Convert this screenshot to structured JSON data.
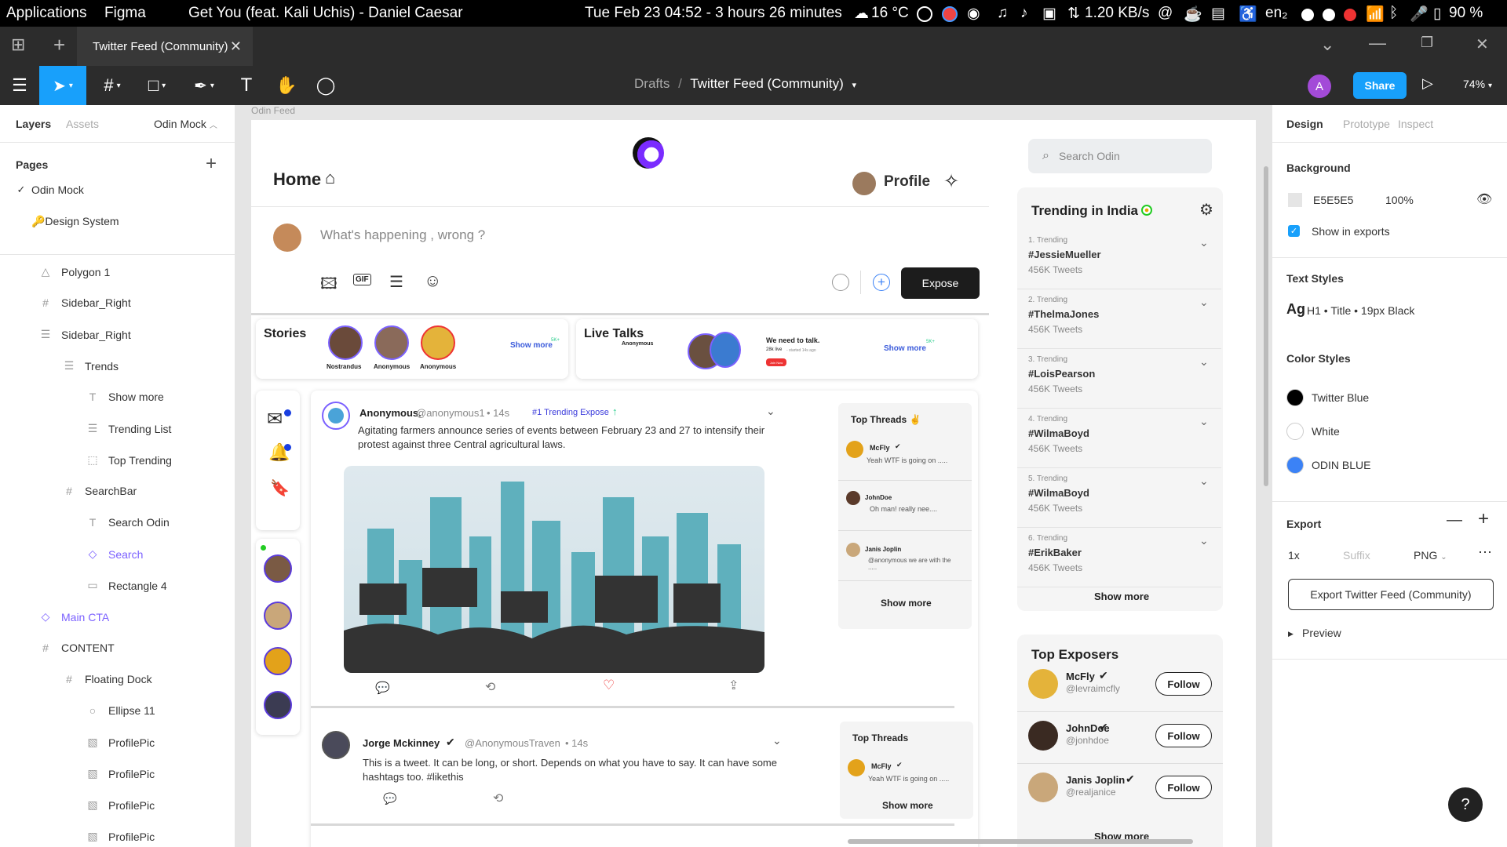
{
  "os_bar": {
    "applications": "Applications",
    "app_name": "Figma",
    "now_playing": "Get You (feat. Kali Uchis) - Daniel Caesar",
    "datetime": "Tue Feb 23  04:52 - 3 hours 26 minutes",
    "weather": "16 °C",
    "network_speed": "1.20 KB/s",
    "keyboard_layout": "en₂",
    "battery": "90 %"
  },
  "tab_bar": {
    "tab_title": "Twitter Feed (Community)"
  },
  "toolbar": {
    "breadcrumb_parent": "Drafts",
    "breadcrumb_sep": "/",
    "file_name": "Twitter Feed (Community)",
    "user_initial": "A",
    "share_label": "Share",
    "zoom": "74%"
  },
  "left_panel": {
    "tab_layers": "Layers",
    "tab_assets": "Assets",
    "page_selector": "Odin Mock",
    "pages_heading": "Pages",
    "pages": [
      {
        "label": "Odin Mock",
        "current": true
      },
      {
        "label": "🔑Design System",
        "current": false
      }
    ],
    "layers": [
      {
        "label": "Polygon 1",
        "icon": "△"
      },
      {
        "label": "Sidebar_Right",
        "icon": "#"
      },
      {
        "label": "Sidebar_Right",
        "icon": "☰"
      },
      {
        "label": "Trends",
        "icon": "☰"
      },
      {
        "label": "Show more",
        "icon": "T"
      },
      {
        "label": "Trending List",
        "icon": "☰"
      },
      {
        "label": "Top Trending",
        "icon": "⬚"
      },
      {
        "label": "SearchBar",
        "icon": "#"
      },
      {
        "label": "Search Odin",
        "icon": "T"
      },
      {
        "label": "Search",
        "icon": "◇"
      },
      {
        "label": "Rectangle 4",
        "icon": "▭"
      },
      {
        "label": "Main CTA",
        "icon": "◇"
      },
      {
        "label": "CONTENT",
        "icon": "#"
      },
      {
        "label": "Floating Dock",
        "icon": "#"
      },
      {
        "label": "Ellipse 11",
        "icon": "○"
      },
      {
        "label": "ProfilePic",
        "icon": "▧"
      },
      {
        "label": "ProfilePic",
        "icon": "▧"
      },
      {
        "label": "ProfilePic",
        "icon": "▧"
      },
      {
        "label": "ProfilePic",
        "icon": "▧"
      }
    ]
  },
  "canvas": {
    "frame_label": "Odin Feed",
    "home_title": "Home",
    "profile_label": "Profile",
    "compose_placeholder": "What's happening , wrong ?",
    "expose_button": "Expose",
    "search_placeholder": "Search Odin",
    "stories": {
      "title": "Stories",
      "names": [
        "Nostrandus",
        "Anonymous",
        "Anonymous"
      ],
      "show_more": "Show more",
      "badge": "5K+"
    },
    "live_talks": {
      "title": "Live Talks",
      "subtitle": "Anonymous",
      "talk_title": "We need to talk.",
      "talk_meta": "28k live",
      "talk_started": "- started 14s ago",
      "join_label": "Join Now",
      "show_more": "Show more",
      "badge": "5K+"
    },
    "tweet1": {
      "name": "Anonymous.",
      "handle": "@anonymous1",
      "time": "14s",
      "tag": "#1 Trending Expose",
      "text": "Agitating farmers announce series of events between February 23 and 27 to intensify their protest against three Central agricultural laws."
    },
    "tweet2": {
      "name": "Jorge Mckinney",
      "handle": "@AnonymousTraven",
      "time": "14s",
      "text": "This is a tweet. It can be long, or short. Depends on what you have to say. It can have some hashtags too. #likethis"
    },
    "top_threads1": {
      "title": "Top Threads ✌️",
      "items": [
        {
          "name": "McFly",
          "text": "Yeah WTF is going on ....."
        },
        {
          "name": "JohnDoe",
          "text": "Oh man! really nee...."
        },
        {
          "name": "Janis Joplin",
          "text": "@anonymous we are with the ....."
        }
      ],
      "show_more": "Show more"
    },
    "top_threads2": {
      "title": "Top Threads",
      "items": [
        {
          "name": "McFly",
          "text": "Yeah WTF is going on ....."
        }
      ],
      "show_more": "Show more"
    },
    "trending": {
      "title": "Trending in India",
      "items": [
        {
          "rank": "1. Trending",
          "tag": "#JessieMueller",
          "count": "456K Tweets"
        },
        {
          "rank": "2. Trending",
          "tag": "#ThelmaJones",
          "count": "456K Tweets"
        },
        {
          "rank": "3. Trending",
          "tag": "#LoisPearson",
          "count": "456K Tweets"
        },
        {
          "rank": "4. Trending",
          "tag": "#WilmaBoyd",
          "count": "456K Tweets"
        },
        {
          "rank": "5. Trending",
          "tag": "#WilmaBoyd",
          "count": "456K Tweets"
        },
        {
          "rank": "6. Trending",
          "tag": "#ErikBaker",
          "count": "456K Tweets"
        }
      ],
      "show_more": "Show more"
    },
    "top_exposers": {
      "title": "Top Exposers",
      "items": [
        {
          "name": "McFly",
          "handle": "@levraimcfly",
          "button": "Follow"
        },
        {
          "name": "JohnDoe",
          "handle": "@jonhdoe",
          "button": "Follow"
        },
        {
          "name": "Janis Joplin",
          "handle": "@realjanice",
          "button": "Follow"
        }
      ],
      "show_more": "Show more"
    }
  },
  "right_panel": {
    "tabs": [
      "Design",
      "Prototype",
      "Inspect"
    ],
    "background_heading": "Background",
    "bg_hex": "E5E5E5",
    "bg_opacity": "100%",
    "show_in_exports": "Show in exports",
    "text_styles_heading": "Text Styles",
    "text_style_sample": "Ag",
    "text_style_name": "H1 • Title • 19px Black",
    "color_styles_heading": "Color Styles",
    "color_styles": [
      {
        "name": "Twitter Blue",
        "color": "#000000"
      },
      {
        "name": "White",
        "color": "#ffffff"
      },
      {
        "name": "ODIN BLUE",
        "color": "#3b82f6"
      }
    ],
    "export_heading": "Export",
    "export_scale": "1x",
    "export_suffix_placeholder": "Suffix",
    "export_format": "PNG",
    "export_button": "Export Twitter Feed (Community)",
    "preview_label": "Preview",
    "help": "?"
  },
  "colors": {
    "figma_blue": "#18a0fb",
    "figma_purple": "#7b61ff",
    "odin_blue": "#3b82f6",
    "dark": "#1c1c1c"
  }
}
